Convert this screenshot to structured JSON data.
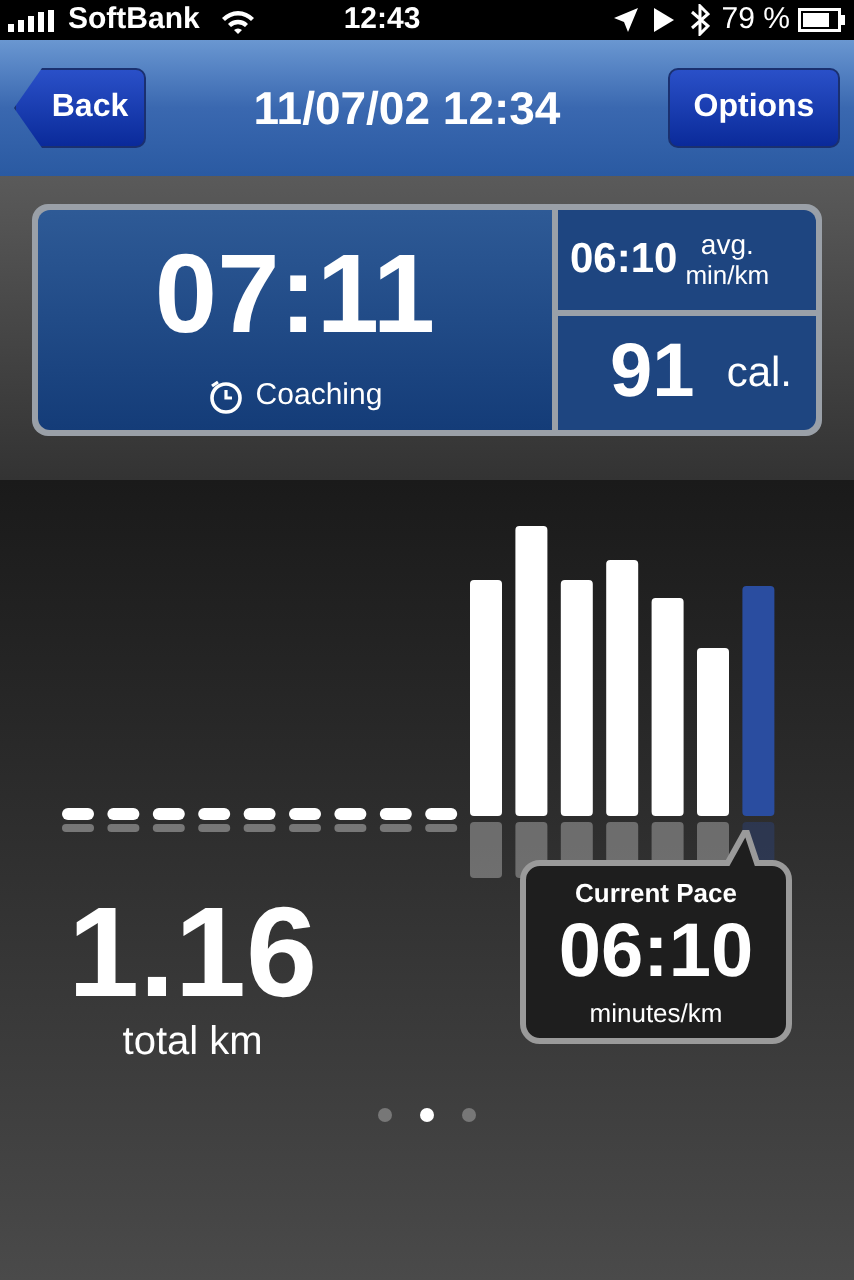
{
  "status_bar": {
    "carrier": "SoftBank",
    "time": "12:43",
    "battery": "79 %"
  },
  "nav_bar": {
    "back": "Back",
    "title": "11/07/02 12:34",
    "options": "Options"
  },
  "summary": {
    "duration": "07:11",
    "coaching": "Coaching",
    "avg_pace": "06:10",
    "avg_label": "avg.",
    "avg_unit": "min/km",
    "calories": "91",
    "calories_unit": "cal."
  },
  "distance": {
    "value": "1.16",
    "label": "total km"
  },
  "current_pace": {
    "title": "Current Pace",
    "value": "06:10",
    "unit": "minutes/km"
  },
  "page_dots": [
    {
      "selected": false
    },
    {
      "selected": true
    },
    {
      "selected": false
    }
  ]
}
